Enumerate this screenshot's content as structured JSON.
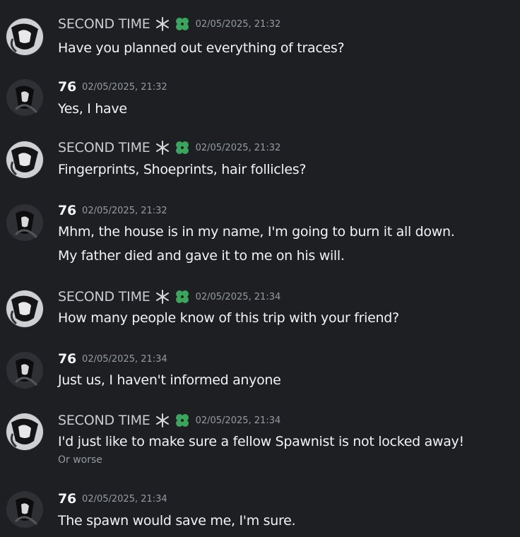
{
  "messages": [
    {
      "user": "SECOND TIME",
      "timestamp": "02/05/2025, 21:32",
      "lines": [
        "Have you planned out everything of traces?"
      ],
      "has_badges": true
    },
    {
      "user": "76",
      "timestamp": "02/05/2025, 21:32",
      "lines": [
        "Yes, I have"
      ],
      "has_badges": false
    },
    {
      "user": "SECOND TIME",
      "timestamp": "02/05/2025, 21:32",
      "lines": [
        "Fingerprints, Shoeprints, hair follicles?"
      ],
      "has_badges": true
    },
    {
      "user": "76",
      "timestamp": "02/05/2025, 21:32",
      "lines": [
        "Mhm, the house is in my name, I'm going to burn it all down.",
        "My father died and gave it to me on his will."
      ],
      "has_badges": false
    },
    {
      "user": "SECOND TIME",
      "timestamp": "02/05/2025, 21:34",
      "lines": [
        "How many people know of this trip with your friend?"
      ],
      "has_badges": true
    },
    {
      "user": "76",
      "timestamp": "02/05/2025, 21:34",
      "lines": [
        "Just us, I haven't informed anyone"
      ],
      "has_badges": false
    },
    {
      "user": "SECOND TIME",
      "timestamp": "02/05/2025, 21:34",
      "lines": [
        "I'd just like to make sure a fellow Spawnist is not locked away!"
      ],
      "has_badges": true,
      "sub": "Or worse"
    },
    {
      "user": "76",
      "timestamp": "02/05/2025, 21:34",
      "lines": [
        "The spawn would save me, I'm sure."
      ],
      "has_badges": false
    }
  ],
  "colors": {
    "background": "#1e1f22",
    "text": "#f2f3f5",
    "muted": "#949ba4",
    "badge_green": "#3ba55d"
  },
  "icons": {
    "badge_1": "snowflake-icon",
    "badge_2": "green-clover-icon"
  }
}
